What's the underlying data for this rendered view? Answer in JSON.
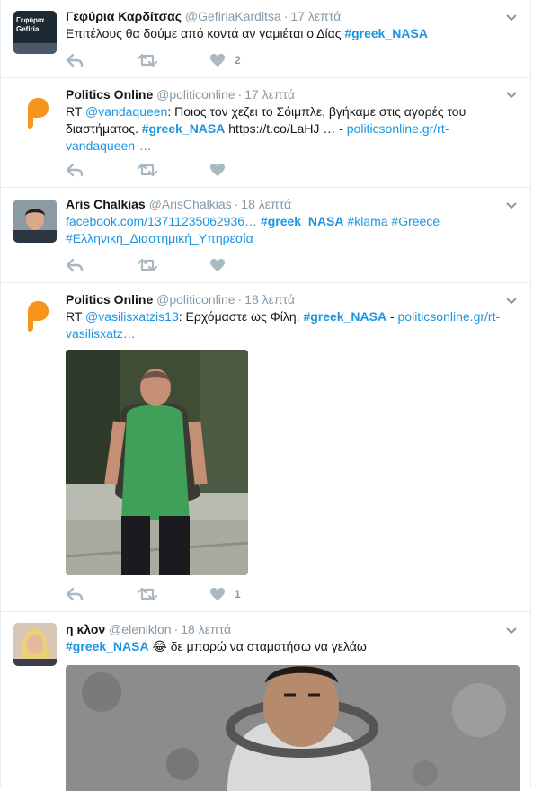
{
  "tweets": [
    {
      "name": "Γεφύρια Καρδίτσας",
      "handle": "@GefiriaKarditsa",
      "time": "17 λεπτά",
      "avatar_text": [
        "Γεφύρια",
        "Gefiria"
      ],
      "parts": [
        {
          "t": "Επιτέλους θα δούμε από κοντά αν γαμιέται ο Δίας ",
          "k": "text"
        },
        {
          "t": "#greek_NASA",
          "k": "tag"
        }
      ],
      "like_count": "2"
    },
    {
      "name": "Politics Online",
      "handle": "@politiconline",
      "time": "17 λεπτά",
      "parts": [
        {
          "t": "RT ",
          "k": "text"
        },
        {
          "t": "@vandaqueen",
          "k": "link"
        },
        {
          "t": ": Ποιος τον χεζει το Σόιμπλε, βγήκαμε στις αγορές του διαστήματος. ",
          "k": "text"
        },
        {
          "t": "#greek_NASA",
          "k": "tag"
        },
        {
          "t": " https://t.co/LaHJ … - ",
          "k": "text"
        },
        {
          "t": "politicsonline.gr/rt-vandaqueen-…",
          "k": "link"
        }
      ],
      "like_count": ""
    },
    {
      "name": "Aris Chalkias",
      "handle": "@ArisChalkias",
      "time": "18 λεπτά",
      "parts": [
        {
          "t": "facebook.com/13711235062936… ",
          "k": "link"
        },
        {
          "t": "#greek_NASA",
          "k": "tag"
        },
        {
          "t": " #klama #Greece #Ελληνική_Διαστημική_Υπηρεσία",
          "k": "link"
        }
      ],
      "like_count": ""
    },
    {
      "name": "Politics Online",
      "handle": "@politiconline",
      "time": "18 λεπτά",
      "parts": [
        {
          "t": "RT ",
          "k": "text"
        },
        {
          "t": "@vasilisxatzis13",
          "k": "link"
        },
        {
          "t": ": Ερχόμαστε ως Φίλη. ",
          "k": "text"
        },
        {
          "t": "#greek_NASA",
          "k": "tag"
        },
        {
          "t": "  - ",
          "k": "text"
        },
        {
          "t": "politicsonline.gr/rt-vasilisxatz…",
          "k": "link"
        }
      ],
      "like_count": "1"
    },
    {
      "name": "η κλον",
      "handle": "@eleniklon",
      "time": "18 λεπτά",
      "parts": [
        {
          "t": "#greek_NASA",
          "k": "tag"
        },
        {
          "t": " 😂 ",
          "k": "text"
        },
        {
          "t": "δε μπορώ να σταματήσω να γελάω",
          "k": "text"
        }
      ],
      "like_count": ""
    }
  ],
  "colors": {
    "link": "#1b95e0",
    "meta": "#8899a6",
    "border": "#e6ecf0",
    "politics_orange": "#f7941d"
  },
  "icons": [
    "reply-icon",
    "retweet-icon",
    "heart-icon",
    "chevron-down-icon"
  ]
}
